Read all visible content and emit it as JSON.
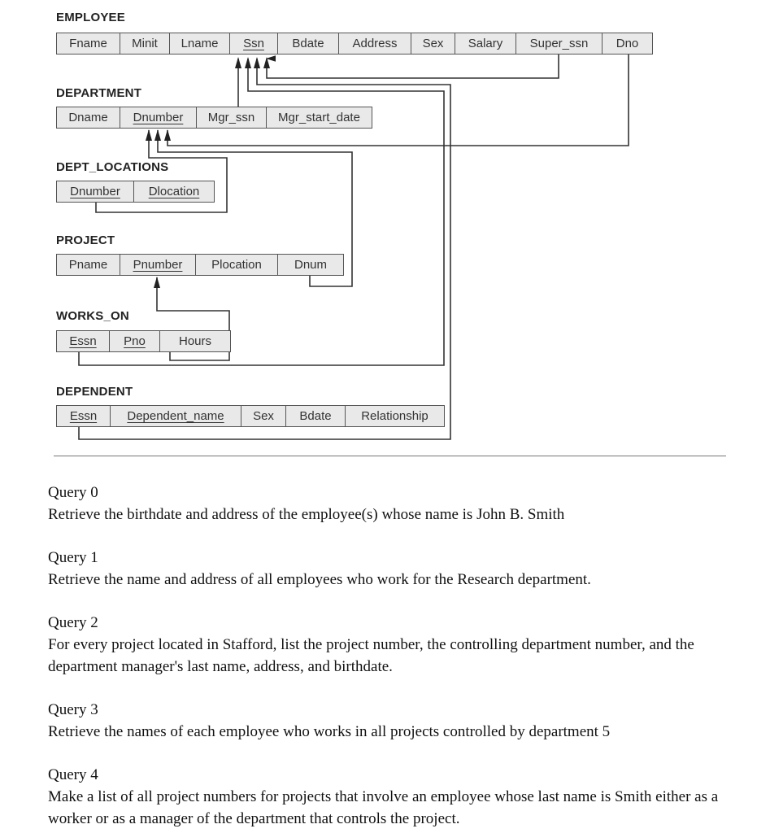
{
  "schema": {
    "tables": [
      {
        "name": "EMPLOYEE",
        "columns": [
          {
            "label": "Fname",
            "key": false
          },
          {
            "label": "Minit",
            "key": false
          },
          {
            "label": "Lname",
            "key": false
          },
          {
            "label": "Ssn",
            "key": true
          },
          {
            "label": "Bdate",
            "key": false
          },
          {
            "label": "Address",
            "key": false
          },
          {
            "label": "Sex",
            "key": false
          },
          {
            "label": "Salary",
            "key": false
          },
          {
            "label": "Super_ssn",
            "key": false
          },
          {
            "label": "Dno",
            "key": false
          }
        ]
      },
      {
        "name": "DEPARTMENT",
        "columns": [
          {
            "label": "Dname",
            "key": false
          },
          {
            "label": "Dnumber",
            "key": true
          },
          {
            "label": "Mgr_ssn",
            "key": false
          },
          {
            "label": "Mgr_start_date",
            "key": false
          }
        ]
      },
      {
        "name": "DEPT_LOCATIONS",
        "columns": [
          {
            "label": "Dnumber",
            "key": true
          },
          {
            "label": "Dlocation",
            "key": true
          }
        ]
      },
      {
        "name": "PROJECT",
        "columns": [
          {
            "label": "Pname",
            "key": false
          },
          {
            "label": "Pnumber",
            "key": true
          },
          {
            "label": "Plocation",
            "key": false
          },
          {
            "label": "Dnum",
            "key": false
          }
        ]
      },
      {
        "name": "WORKS_ON",
        "columns": [
          {
            "label": "Essn",
            "key": true
          },
          {
            "label": "Pno",
            "key": true
          },
          {
            "label": "Hours",
            "key": false
          }
        ]
      },
      {
        "name": "DEPENDENT",
        "columns": [
          {
            "label": "Essn",
            "key": true
          },
          {
            "label": "Dependent_name",
            "key": true
          },
          {
            "label": "Sex",
            "key": false
          },
          {
            "label": "Bdate",
            "key": false
          },
          {
            "label": "Relationship",
            "key": false
          }
        ]
      }
    ]
  },
  "queries": [
    {
      "title": "Query 0",
      "text": "Retrieve the birthdate and address of the employee(s) whose name is John B. Smith"
    },
    {
      "title": "Query 1",
      "text": "Retrieve the name and address of all employees who work for the Research department."
    },
    {
      "title": "Query 2",
      "text": "For every project located in Stafford, list the project number, the controlling department number, and the department manager's last name, address, and birthdate."
    },
    {
      "title": "Query 3",
      "text": "Retrieve the names of each employee who works in all projects controlled by department 5"
    },
    {
      "title": "Query 4",
      "text": "Make a list of all project numbers for projects that involve an employee whose last name is Smith either as a worker or as a manager of the department that controls the project."
    }
  ]
}
